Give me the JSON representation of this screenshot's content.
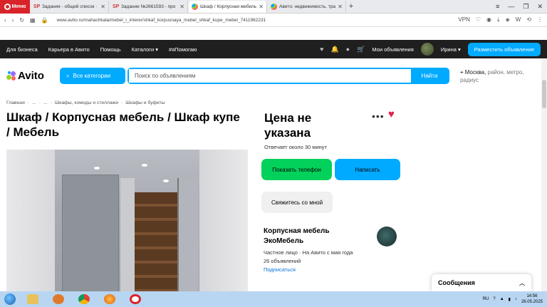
{
  "browser": {
    "menu_label": "Меню",
    "tabs": [
      {
        "title": "Задания - общий список ·",
        "active": false
      },
      {
        "title": "Задание №2661593 - про",
        "active": false
      },
      {
        "title": "Шкаф / Корпусная мебель",
        "active": true
      },
      {
        "title": "Авито: недвижимость, тра",
        "active": false
      }
    ],
    "url": "www.avito.ru/mahachkala/mebel_i_interer/shkaf_korpusnaya_mebel_shkaf_kupe_mebel_7411962231"
  },
  "topnav": {
    "links": [
      "Для бизнеса",
      "Карьера в Авито",
      "Помощь",
      "Каталоги",
      "#яПомогаю"
    ],
    "my_ads": "Мои объявления",
    "user": "Ирина",
    "post_ad": "Разместить объявление"
  },
  "header": {
    "logo": "Avito",
    "categories_btn": "Все категории",
    "search_placeholder": "Поиск по объявлениям",
    "search_btn": "Найти",
    "location_city": "Москва,",
    "location_rest": "район, метро, радиус"
  },
  "breadcrumb": [
    "Главная",
    "·",
    "...",
    "·",
    "...",
    "·",
    "Шкафы, комоды и стеллажи",
    "·",
    "Шкафы и буфеты"
  ],
  "listing": {
    "title": "Шкаф / Корпусная мебель / Шкаф купе / Мебель",
    "price": "Цена не указана",
    "reply_time": "Отвечает около 30 минут",
    "show_phone": "Показать телефон",
    "write": "Написать",
    "contact_me": "Свяжитесь со мной"
  },
  "seller": {
    "name": "Корпусная мебель ЭкоМебель",
    "info": "Частное лицо · На Авито с мая года",
    "ads_count": "26 объявлений",
    "subscribe": "Подписаться"
  },
  "messages": {
    "label": "Сообщения"
  },
  "taskbar": {
    "lang": "RU",
    "time": "14:56",
    "date": "26.05.2025"
  },
  "colors": {
    "avito_blue": "#00aaff",
    "phone_green": "#02d15c",
    "heart": "#e0234a",
    "nav_dark": "#1f1f1f"
  }
}
